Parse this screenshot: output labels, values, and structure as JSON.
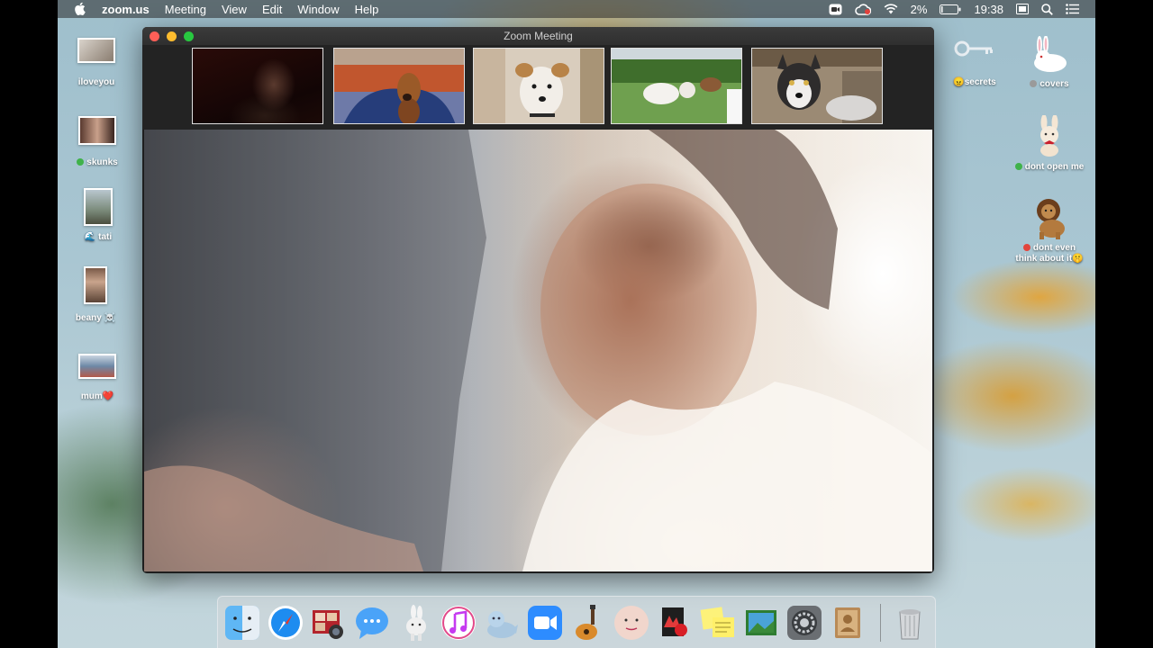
{
  "menubar": {
    "app_name": "zoom.us",
    "menus": [
      "Meeting",
      "View",
      "Edit",
      "Window",
      "Help"
    ],
    "battery_percent": "2%",
    "time": "19:38"
  },
  "window": {
    "title": "Zoom Meeting"
  },
  "desktop_left": [
    {
      "label": "iloveyou"
    },
    {
      "label": "skunks",
      "dot": "#3fb24a"
    },
    {
      "label": "tati",
      "emoji": "🌊"
    },
    {
      "label": "beany",
      "emoji": "☠️"
    },
    {
      "label": "mum",
      "emoji": "❤️"
    }
  ],
  "desktop_right": [
    {
      "label": "secrets",
      "emoji": "😠"
    },
    {
      "label": "covers",
      "dot": "#9a9a9a"
    },
    {
      "label": "dont open me",
      "dot": "#3fb24a"
    },
    {
      "label_line1": "dont even",
      "label_line2": "think about it",
      "emoji": "🤫",
      "dot": "#e2453c"
    }
  ],
  "participants": [
    "participant-person",
    "participant-dachshund",
    "participant-terrier",
    "participant-dogs-garden",
    "participant-husky"
  ],
  "dock": [
    "finder",
    "safari",
    "photo-booth",
    "messages",
    "launchpad",
    "itunes",
    "seal",
    "zoom",
    "garageband",
    "face",
    "pdf",
    "stickies",
    "preview",
    "system-preferences",
    "contacts",
    "trash"
  ],
  "colors": {
    "zoom_blue": "#2d8cff",
    "close": "#fe5f57",
    "minimize": "#febc2e",
    "maximize": "#28c840"
  }
}
